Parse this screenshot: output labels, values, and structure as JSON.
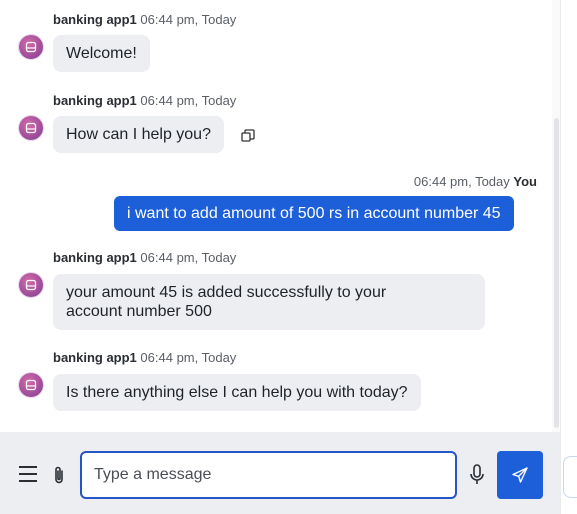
{
  "messages": [
    {
      "sender": "banking app1",
      "time": "06:44 pm, Today",
      "text": "Welcome!"
    },
    {
      "sender": "banking app1",
      "time": "06:44 pm, Today",
      "text": "How can I help you?"
    },
    {
      "sender": "You",
      "time": "06:44 pm, Today",
      "text": "i want to add amount of 500 rs in account number 45"
    },
    {
      "sender": "banking app1",
      "time": "06:44 pm, Today",
      "line1": "your amount 45 is added successfully to your",
      "line2": "account number 500"
    },
    {
      "sender": "banking app1",
      "time": "06:44 pm, Today",
      "text": "Is there anything else I can help you with today?"
    }
  ],
  "composer": {
    "placeholder": "Type a message"
  },
  "icons": {
    "avatar": "bot-avatar-icon",
    "copy": "copy-icon",
    "menu": "menu-icon",
    "attach": "paperclip-icon",
    "mic": "microphone-icon",
    "send": "send-icon"
  },
  "colors": {
    "accent": "#1c5fd8",
    "bubble_bot": "#eceef2",
    "composer_bg": "#eceef1"
  }
}
